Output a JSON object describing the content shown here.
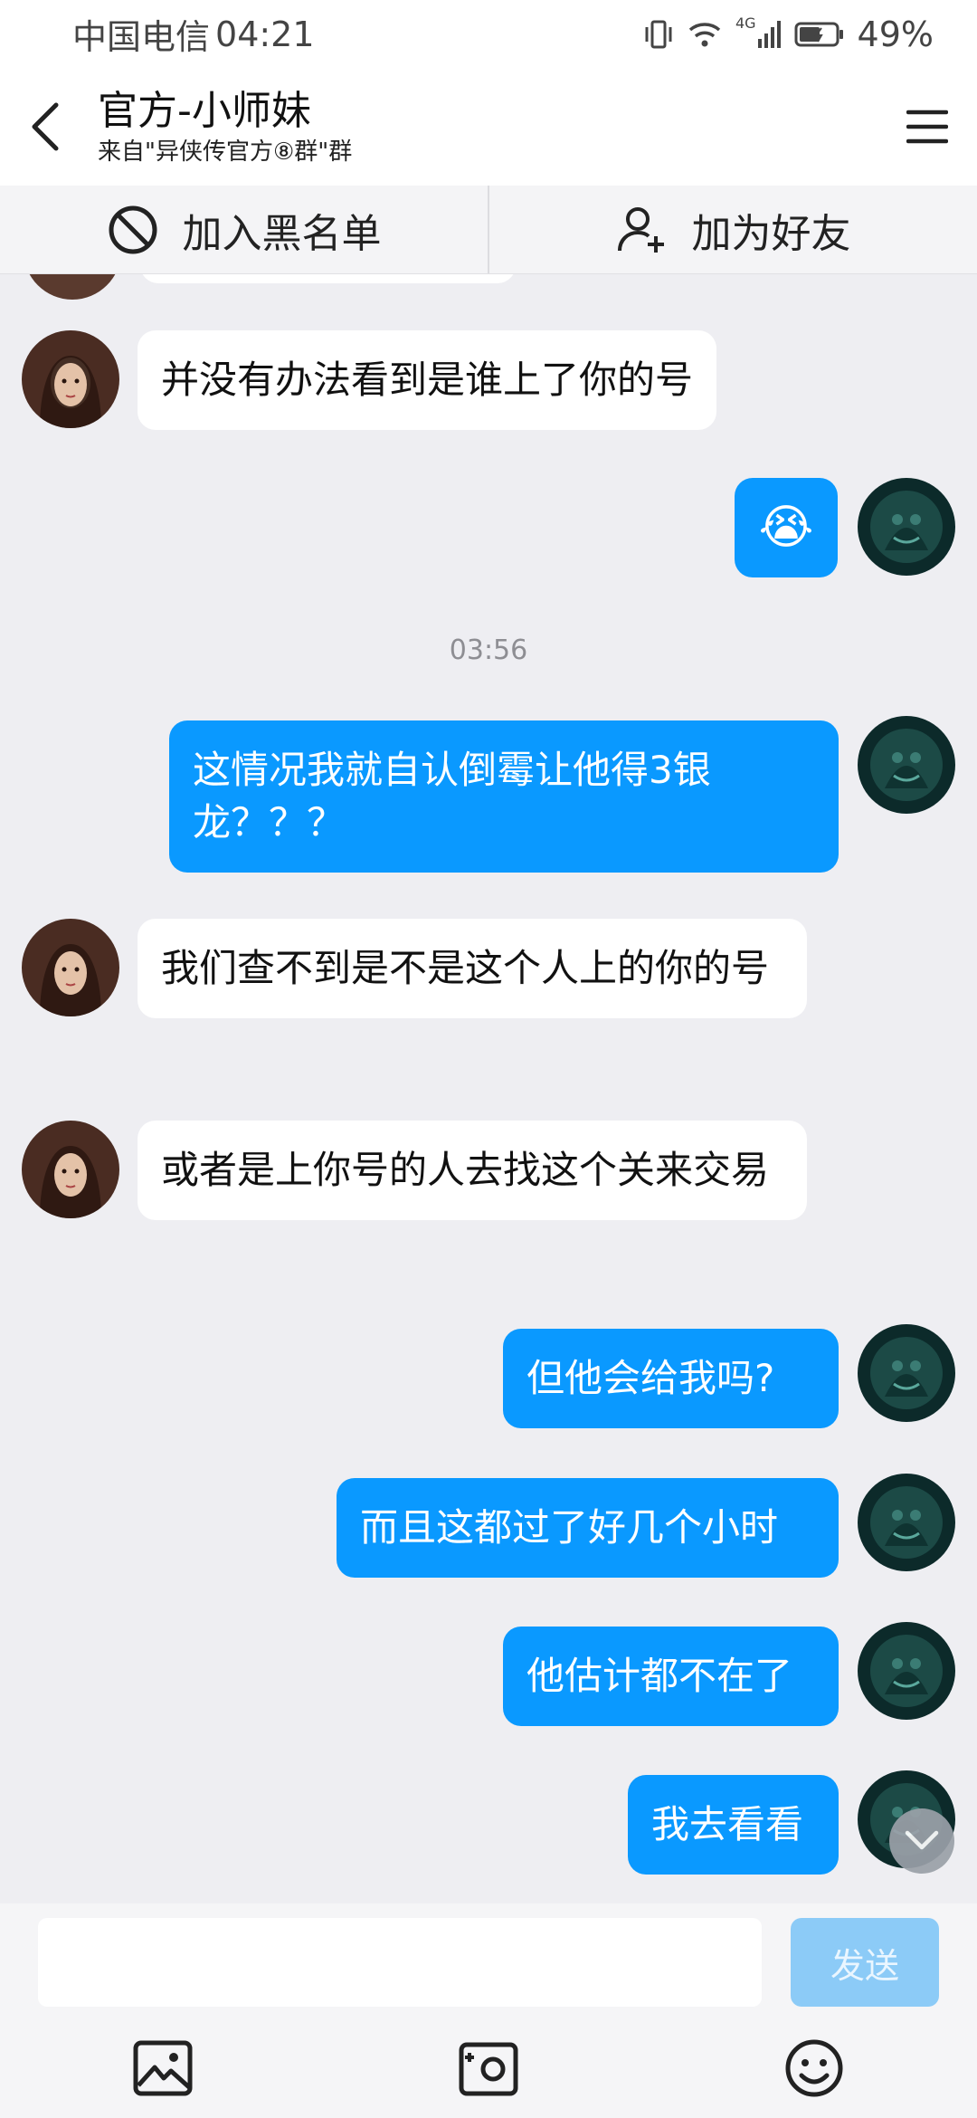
{
  "status_bar": {
    "carrier": "中国电信",
    "time": "04:21",
    "network": "4G",
    "battery": "49%"
  },
  "header": {
    "title": "官方-小师妹",
    "subtitle": "来自\"异侠传官方⑧群\"群"
  },
  "actions": {
    "block_label": "加入黑名单",
    "add_friend_label": "加为好友"
  },
  "chat": {
    "time_divider": "03:56",
    "messages": [
      {
        "side": "in",
        "text": "并没有办法看到是谁上了你的号"
      },
      {
        "side": "out",
        "text": "😭"
      },
      {
        "side": "out",
        "text": "这情况我就自认倒霉让他得3银龙？？？"
      },
      {
        "side": "in",
        "text": "我们查不到是不是这个人上的你的号"
      },
      {
        "side": "in",
        "text": "或者是上你号的人去找这个关来交易"
      },
      {
        "side": "out",
        "text": "但他会给我吗?"
      },
      {
        "side": "out",
        "text": "而且这都过了好几个小时"
      },
      {
        "side": "out",
        "text": "他估计都不在了"
      },
      {
        "side": "out",
        "text": "我去看看"
      }
    ]
  },
  "input": {
    "value": "",
    "placeholder": "",
    "send_label": "发送"
  },
  "toolbar": {
    "icons": [
      "image-icon",
      "camera-icon",
      "emoji-icon"
    ]
  },
  "colors": {
    "outgoing_bubble": "#0a99ff",
    "incoming_bubble": "#ffffff",
    "chat_background": "#eeeef2",
    "send_button_disabled": "#8ccbf7"
  }
}
